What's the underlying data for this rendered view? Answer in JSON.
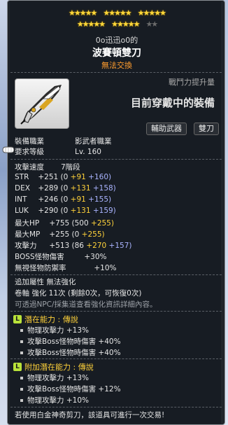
{
  "stars": {
    "row1_filled": "★★★★★",
    "row1_g2": "★★★★★",
    "row1_g3": "★★★★★",
    "row2_g1": "★★★★★",
    "row2_g2": "★★★★★",
    "row2_dim": "★★"
  },
  "owner": "0o迅迅o0的",
  "item_name": "波賽頓雙刀",
  "trade": "無法交換",
  "power_label": "戰鬥力提升量",
  "power_value": "目前穿戴中的裝備",
  "tags": [
    "輔助武器",
    "雙刀"
  ],
  "req_job_label": "裝備職業",
  "req_job_value": "影武者職業",
  "req_level_label": "要求等級",
  "req_level_value": "Lv. 160",
  "attack_speed_label": "攻擊速度",
  "attack_speed_value": "7階段",
  "stats": [
    {
      "k": "STR",
      "total": "+251",
      "base": "(0",
      "add1": "+91",
      "add2": "+160)"
    },
    {
      "k": "DEX",
      "total": "+289",
      "base": "(0",
      "add1": "+131",
      "add2": "+158)"
    },
    {
      "k": "INT",
      "total": "+246",
      "base": "(0",
      "add1": "+91",
      "add2": "+155)"
    },
    {
      "k": "LUK",
      "total": "+290",
      "base": "(0",
      "add1": "+131",
      "add2": "+159)"
    }
  ],
  "maxhp": {
    "k": "最大HP",
    "total": "+755",
    "base": "(500",
    "add1": "+255)"
  },
  "maxmp": {
    "k": "最大MP",
    "total": "+255",
    "base": "(0",
    "add1": "+255)"
  },
  "atk": {
    "k": "攻擊力",
    "total": "+513",
    "base": "(86",
    "add1": "+270",
    "add2": "+157)"
  },
  "boss": {
    "k": "BOSS怪物傷害",
    "v": "+30%"
  },
  "ignore": {
    "k": "無視怪物防禦率",
    "v": "+10%"
  },
  "extra_prop": "追加屬性 無法強化",
  "scroll": "卷軸 強化 11次 (剩餘0次，可恢復0次)",
  "npc_note": "可透過NPC/採集道查看強化資訊詳細內容。",
  "potential": {
    "badge": "L",
    "title": "潛在能力 : 傳說",
    "lines": [
      "物理攻擊力 +13%",
      "攻擊Boss怪物時傷害 +40%",
      "攻擊Boss怪物時傷害 +40%"
    ]
  },
  "bonus_potential": {
    "badge": "L",
    "title": "附加潛在能力 : 傳說",
    "lines": [
      "物理攻擊力 +13%",
      "攻擊Boss怪物時傷害 +12%",
      "物理攻擊力 +10%"
    ]
  },
  "footer": "若使用白金神奇剪刀，該道具可進行一次交易!",
  "colors": {
    "trade": "#ff9d2e",
    "bonus": "#ffd23a",
    "scroll": "#aab4ff",
    "legend": "#b8e23a"
  }
}
